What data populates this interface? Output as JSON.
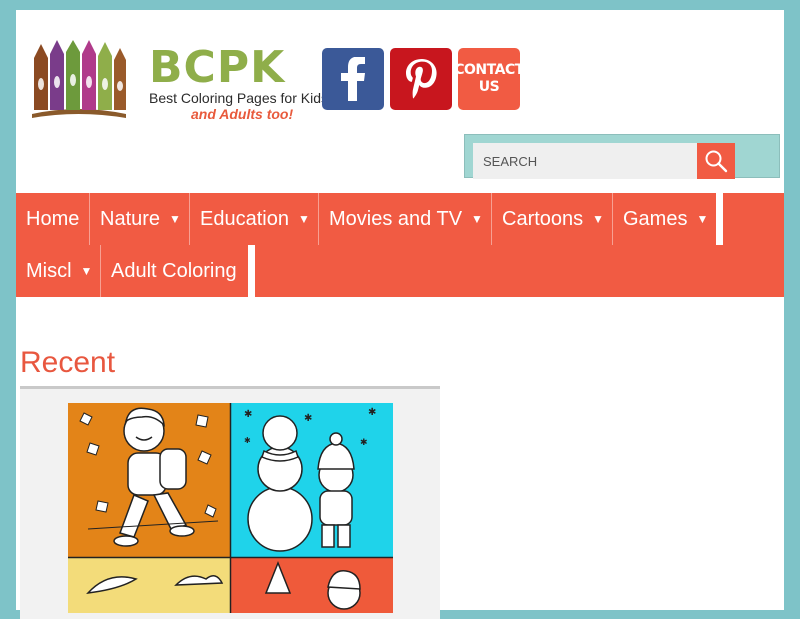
{
  "header": {
    "brand_title": "BCPK",
    "brand_tagline": "Best Coloring Pages for Kids",
    "brand_tagline2": "and Adults too!",
    "contact_label_line1": "CONTACT",
    "contact_label_line2": "US"
  },
  "search": {
    "placeholder": "SEARCH"
  },
  "nav": {
    "items": [
      {
        "label": "Home",
        "dropdown": false
      },
      {
        "label": "Nature",
        "dropdown": true
      },
      {
        "label": "Education",
        "dropdown": true
      },
      {
        "label": "Movies and TV",
        "dropdown": true
      },
      {
        "label": "Cartoons",
        "dropdown": true
      },
      {
        "label": "Games",
        "dropdown": true
      },
      {
        "label": "Miscl",
        "dropdown": true
      },
      {
        "label": "Adult Coloring",
        "dropdown": false
      }
    ],
    "caret": "▼"
  },
  "main": {
    "section_title": "Recent"
  },
  "colors": {
    "accent": "#f15b43",
    "background": "#7ec3c8",
    "facebook": "#3b5998",
    "pinterest": "#c8161e",
    "brand_green": "#8fae4a"
  }
}
